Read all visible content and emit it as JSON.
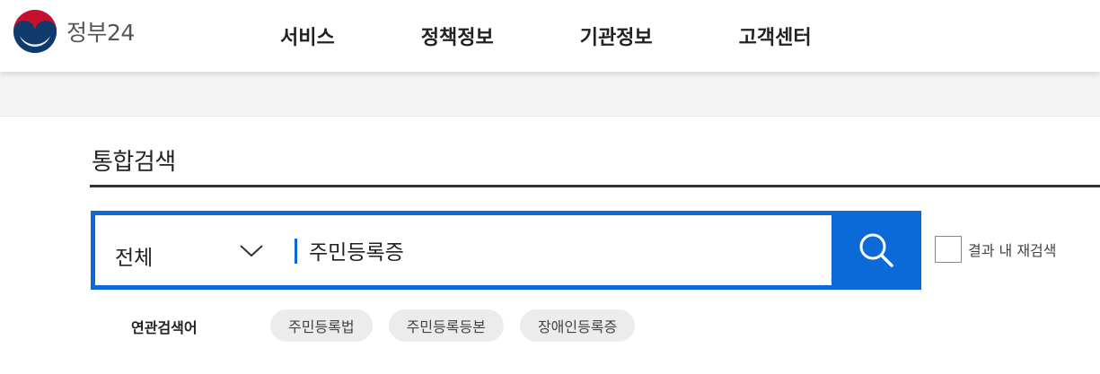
{
  "header": {
    "logo_text": "정부24",
    "nav": [
      {
        "label": "서비스"
      },
      {
        "label": "정책정보"
      },
      {
        "label": "기관정보"
      },
      {
        "label": "고객센터"
      }
    ]
  },
  "page": {
    "title": "통합검색"
  },
  "search": {
    "scope": "전체",
    "query": "주민등록증",
    "refine_label": "결과 내 재검색"
  },
  "related": {
    "label": "연관검색어",
    "keywords": [
      "주민등록법",
      "주민등록등본",
      "장애인등록증"
    ]
  },
  "colors": {
    "accent": "#0b6ad8",
    "logo_red": "#c8102e",
    "logo_navy": "#0f3a6b"
  }
}
